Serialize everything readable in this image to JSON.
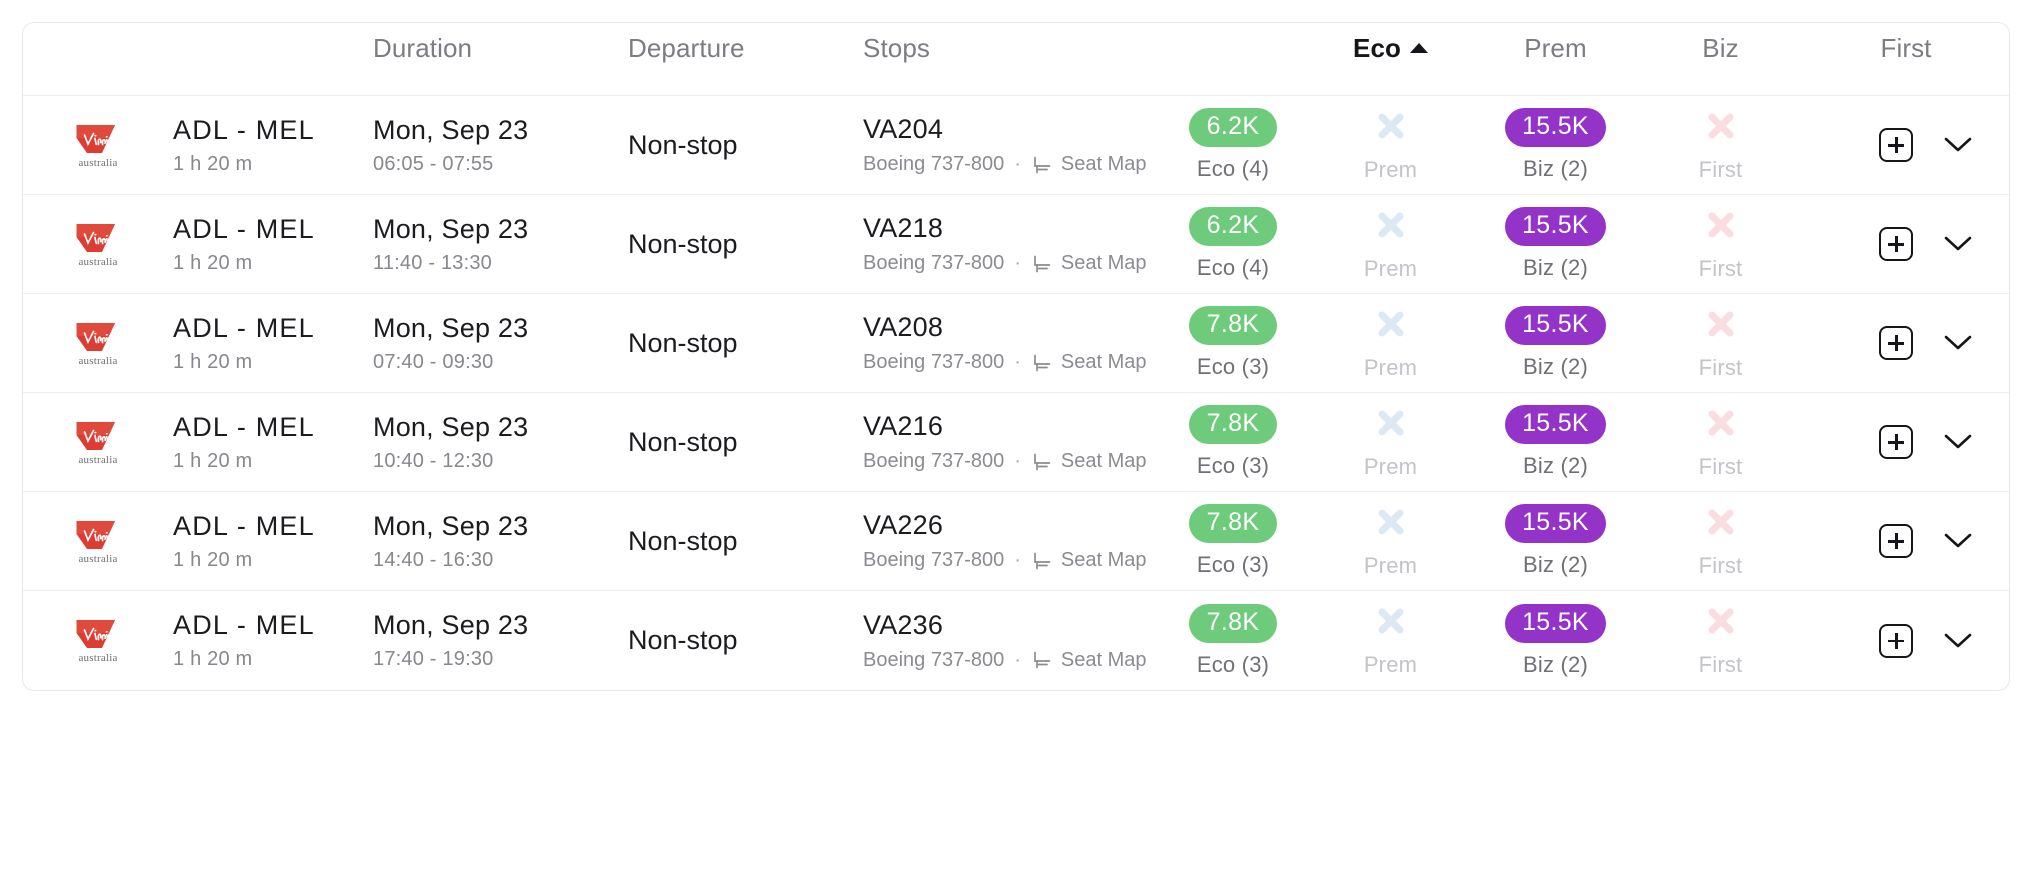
{
  "table": {
    "columns": [
      {
        "key": "airline",
        "label": ""
      },
      {
        "key": "route",
        "label": ""
      },
      {
        "key": "duration",
        "label": "Duration"
      },
      {
        "key": "departure",
        "label": "Departure"
      },
      {
        "key": "stops",
        "label": "Stops"
      },
      {
        "key": "flight",
        "label": ""
      },
      {
        "key": "eco",
        "label": "Eco",
        "sorted": "asc"
      },
      {
        "key": "prem",
        "label": "Prem"
      },
      {
        "key": "biz",
        "label": "Biz"
      },
      {
        "key": "first",
        "label": "First"
      }
    ],
    "headers": {
      "duration": "Duration",
      "departure": "Departure",
      "stops": "Stops",
      "eco": "Eco",
      "prem": "Prem",
      "biz": "Biz",
      "first": "First"
    },
    "sort": {
      "column": "Eco",
      "direction": "ascending",
      "indicator": "caret-up-icon"
    }
  },
  "colors": {
    "eco_badge": "#6ECB7B",
    "biz_badge": "#9333C8",
    "prem_unavailable_x": "#DCE9F5",
    "first_unavailable_x": "#FADDE1",
    "airline_red": "#DC3C31",
    "row_divider": "#EEEEF0",
    "text_primary": "#1C1C20",
    "text_muted": "#87878D"
  },
  "airline": {
    "name": "Virgin Australia",
    "logo_icon": "virgin-australia-tailfin-icon",
    "wordmark": "australia",
    "script": "Virgin"
  },
  "icons": {
    "seat_map": "seat-icon",
    "add": "plus-square-icon",
    "expand": "chevron-down-icon",
    "unavailable": "x-icon",
    "sort_asc": "caret-up-icon"
  },
  "rows": [
    {
      "route": "ADL - MEL",
      "duration": "1 h 20 m",
      "departure_date": "Mon, Sep 23",
      "departure_times": "06:05 - 07:55",
      "stops": "Non-stop",
      "flight_number": "VA204",
      "aircraft": "Boeing 737-800",
      "seat_map_label": "Seat Map",
      "eco": {
        "price": "6.2K",
        "label": "Eco (4)",
        "available": true
      },
      "prem": {
        "price": "",
        "label": "Prem",
        "available": false
      },
      "biz": {
        "price": "15.5K",
        "label": "Biz (2)",
        "available": true
      },
      "first": {
        "price": "",
        "label": "First",
        "available": false
      }
    },
    {
      "route": "ADL - MEL",
      "duration": "1 h 20 m",
      "departure_date": "Mon, Sep 23",
      "departure_times": "11:40 - 13:30",
      "stops": "Non-stop",
      "flight_number": "VA218",
      "aircraft": "Boeing 737-800",
      "seat_map_label": "Seat Map",
      "eco": {
        "price": "6.2K",
        "label": "Eco (4)",
        "available": true
      },
      "prem": {
        "price": "",
        "label": "Prem",
        "available": false
      },
      "biz": {
        "price": "15.5K",
        "label": "Biz (2)",
        "available": true
      },
      "first": {
        "price": "",
        "label": "First",
        "available": false
      }
    },
    {
      "route": "ADL - MEL",
      "duration": "1 h 20 m",
      "departure_date": "Mon, Sep 23",
      "departure_times": "07:40 - 09:30",
      "stops": "Non-stop",
      "flight_number": "VA208",
      "aircraft": "Boeing 737-800",
      "seat_map_label": "Seat Map",
      "eco": {
        "price": "7.8K",
        "label": "Eco (3)",
        "available": true
      },
      "prem": {
        "price": "",
        "label": "Prem",
        "available": false
      },
      "biz": {
        "price": "15.5K",
        "label": "Biz (2)",
        "available": true
      },
      "first": {
        "price": "",
        "label": "First",
        "available": false
      }
    },
    {
      "route": "ADL - MEL",
      "duration": "1 h 20 m",
      "departure_date": "Mon, Sep 23",
      "departure_times": "10:40 - 12:30",
      "stops": "Non-stop",
      "flight_number": "VA216",
      "aircraft": "Boeing 737-800",
      "seat_map_label": "Seat Map",
      "eco": {
        "price": "7.8K",
        "label": "Eco (3)",
        "available": true
      },
      "prem": {
        "price": "",
        "label": "Prem",
        "available": false
      },
      "biz": {
        "price": "15.5K",
        "label": "Biz (2)",
        "available": true
      },
      "first": {
        "price": "",
        "label": "First",
        "available": false
      }
    },
    {
      "route": "ADL - MEL",
      "duration": "1 h 20 m",
      "departure_date": "Mon, Sep 23",
      "departure_times": "14:40 - 16:30",
      "stops": "Non-stop",
      "flight_number": "VA226",
      "aircraft": "Boeing 737-800",
      "seat_map_label": "Seat Map",
      "eco": {
        "price": "7.8K",
        "label": "Eco (3)",
        "available": true
      },
      "prem": {
        "price": "",
        "label": "Prem",
        "available": false
      },
      "biz": {
        "price": "15.5K",
        "label": "Biz (2)",
        "available": true
      },
      "first": {
        "price": "",
        "label": "First",
        "available": false
      }
    },
    {
      "route": "ADL - MEL",
      "duration": "1 h 20 m",
      "departure_date": "Mon, Sep 23",
      "departure_times": "17:40 - 19:30",
      "stops": "Non-stop",
      "flight_number": "VA236",
      "aircraft": "Boeing 737-800",
      "seat_map_label": "Seat Map",
      "eco": {
        "price": "7.8K",
        "label": "Eco (3)",
        "available": true
      },
      "prem": {
        "price": "",
        "label": "Prem",
        "available": false
      },
      "biz": {
        "price": "15.5K",
        "label": "Biz (2)",
        "available": true
      },
      "first": {
        "price": "",
        "label": "First",
        "available": false
      }
    }
  ]
}
